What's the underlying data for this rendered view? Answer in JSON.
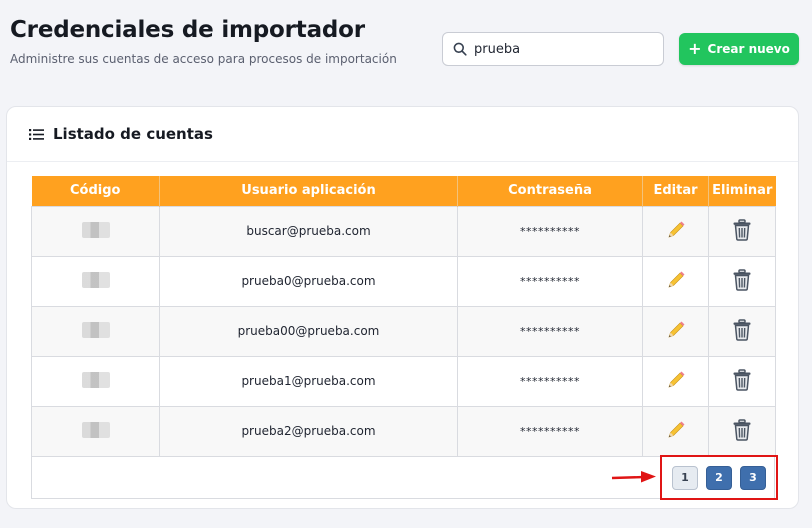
{
  "header": {
    "title": "Credenciales de importador",
    "subtitle": "Administre sus cuentas de acceso para procesos de importación"
  },
  "search": {
    "value": "prueba"
  },
  "create_button": {
    "label": "Crear nuevo"
  },
  "card": {
    "title": "Listado de cuentas"
  },
  "table": {
    "columns": [
      "Código",
      "Usuario aplicación",
      "Contraseña",
      "Editar",
      "Eliminar"
    ],
    "rows": [
      {
        "user": "buscar@prueba.com",
        "password": "**********"
      },
      {
        "user": "prueba0@prueba.com",
        "password": "**********"
      },
      {
        "user": "prueba00@prueba.com",
        "password": "**********"
      },
      {
        "user": "prueba1@prueba.com",
        "password": "**********"
      },
      {
        "user": "prueba2@prueba.com",
        "password": "**********"
      }
    ]
  },
  "pagination": {
    "pages": [
      "1",
      "2",
      "3"
    ],
    "current": "1"
  },
  "colors": {
    "header_orange": "#ffa11f",
    "create_green": "#22c55e",
    "page_active_blue": "#3f6fad",
    "highlight_red": "#e01515"
  },
  "icons": [
    "search-icon",
    "plus-icon",
    "list-icon",
    "pencil-icon",
    "trash-icon",
    "arrow-right-icon"
  ]
}
